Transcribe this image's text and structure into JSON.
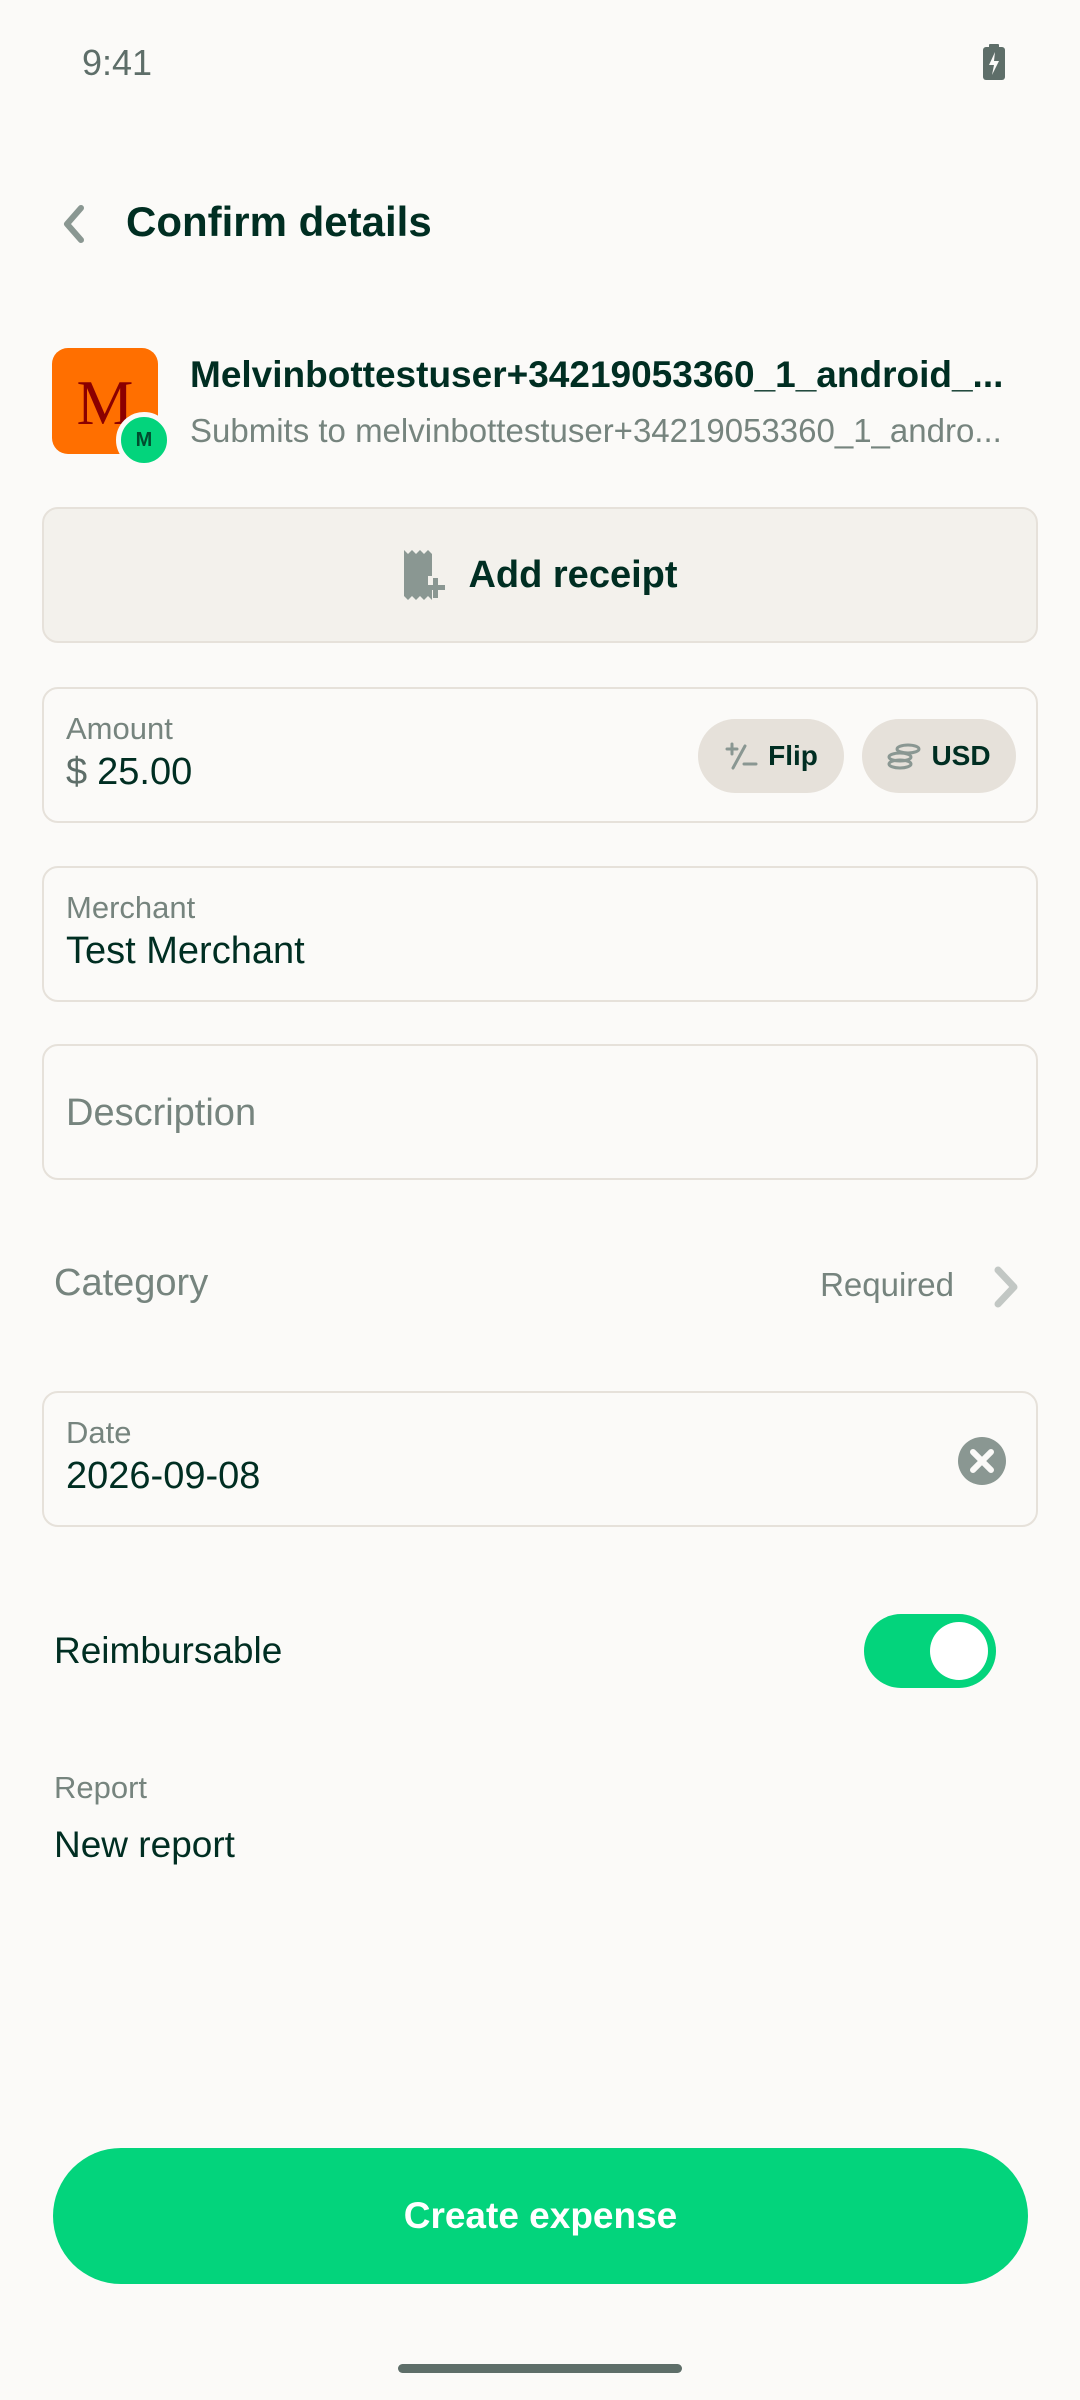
{
  "status_bar": {
    "time": "9:41",
    "battery_icon": "battery-charging-icon"
  },
  "header": {
    "title": "Confirm details",
    "back_icon": "chevron-left-icon"
  },
  "participant": {
    "avatar_letter": "M",
    "badge_letter": "M",
    "name": "Melvinbottestuser+34219053360_1_android_...",
    "subtitle": "Submits to melvinbottestuser+34219053360_1_andro..."
  },
  "receipt": {
    "label": "Add receipt",
    "icon": "receipt-plus-icon"
  },
  "amount": {
    "label": "Amount",
    "currency_symbol": "$",
    "value": "25.00",
    "flip_label": "Flip",
    "flip_icon": "plus-minus-icon",
    "currency_label": "USD",
    "currency_icon": "coins-icon"
  },
  "merchant": {
    "label": "Merchant",
    "value": "Test Merchant"
  },
  "description": {
    "placeholder": "Description",
    "value": ""
  },
  "category": {
    "label": "Category",
    "status": "Required",
    "icon": "chevron-right-icon"
  },
  "date": {
    "label": "Date",
    "value": "2026-09-08",
    "clear_icon": "clear-circle-icon"
  },
  "reimbursable": {
    "label": "Reimbursable",
    "enabled": true
  },
  "report": {
    "label": "Report",
    "value": "New report"
  },
  "submit": {
    "label": "Create expense"
  },
  "colors": {
    "accent": "#03D47C",
    "text": "#002E22",
    "muted": "#76847E",
    "border": "#E6E1DA",
    "background": "#FBFAF8",
    "avatar": "#FF6F00"
  }
}
